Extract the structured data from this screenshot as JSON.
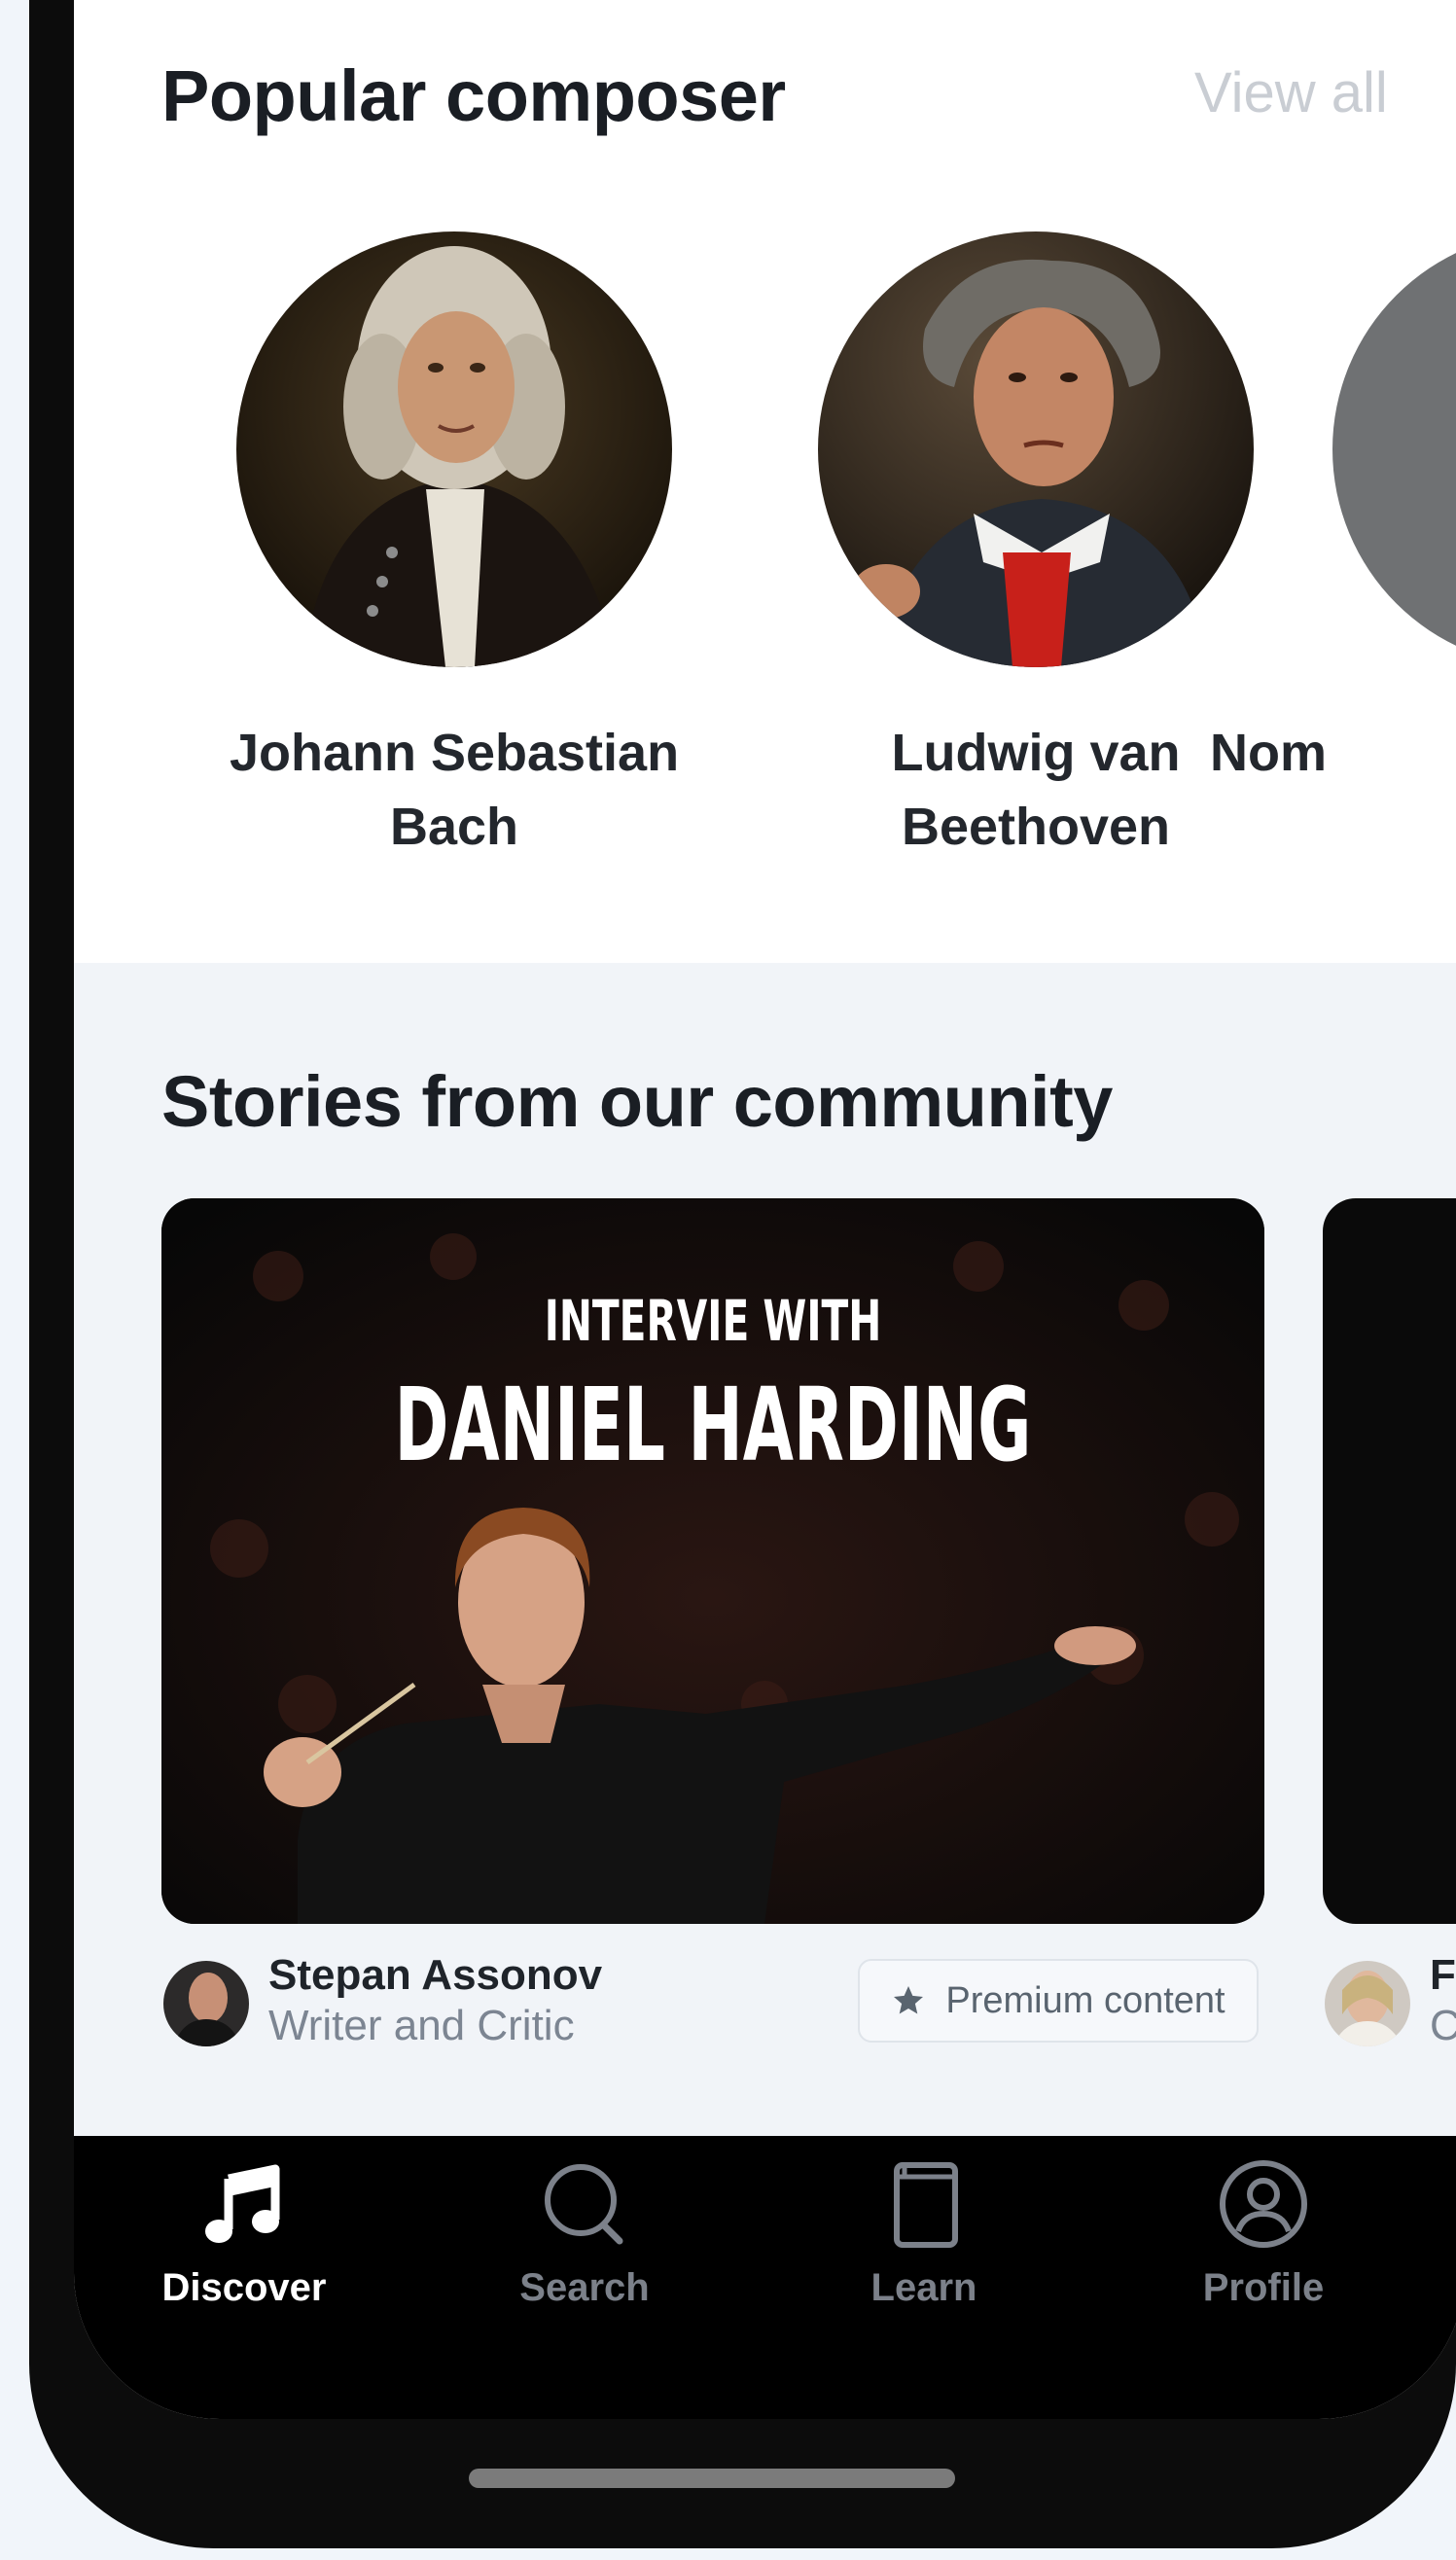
{
  "composers_section": {
    "title": "Popular composer",
    "view_all": "View all",
    "items": [
      {
        "name": "Johann Sebastian Bach"
      },
      {
        "name": "Ludwig van Beethoven"
      },
      {
        "name": "Nom"
      }
    ]
  },
  "stories_section": {
    "title": "Stories from our community",
    "cards": [
      {
        "line1": "INTERVIE WITH",
        "line2": "DANIEL HARDING",
        "author_name": "Stepan Assonov",
        "author_role": "Writer and Critic",
        "badge": "Premium content"
      },
      {
        "author_name": "Fr",
        "author_role": "C"
      }
    ]
  },
  "tabbar": {
    "tabs": [
      {
        "label": "Discover",
        "icon": "music-note-icon",
        "active": true
      },
      {
        "label": "Search",
        "icon": "search-icon",
        "active": false
      },
      {
        "label": "Learn",
        "icon": "book-icon",
        "active": false
      },
      {
        "label": "Profile",
        "icon": "profile-icon",
        "active": false
      }
    ]
  },
  "colors": {
    "background": "#f1f5fa",
    "text_primary": "#1a1e24",
    "muted": "#c9cdd3",
    "tabbar": "#000000",
    "tab_active": "#ffffff",
    "tab_inactive": "#7c818a"
  }
}
